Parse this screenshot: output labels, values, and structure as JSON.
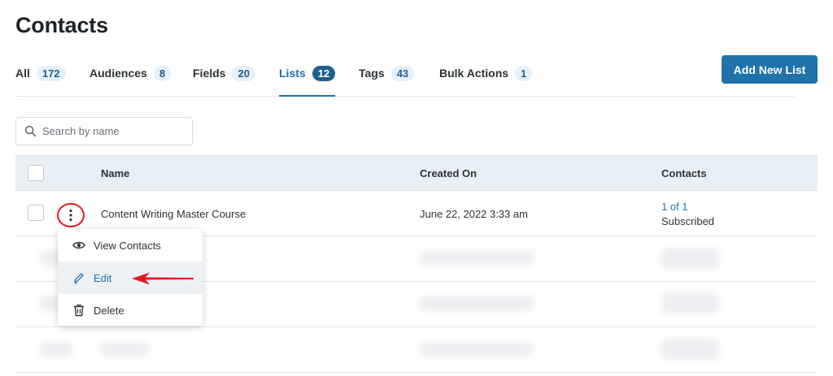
{
  "page": {
    "title": "Contacts"
  },
  "tabs": [
    {
      "label": "All",
      "count": "172"
    },
    {
      "label": "Audiences",
      "count": "8"
    },
    {
      "label": "Fields",
      "count": "20"
    },
    {
      "label": "Lists",
      "count": "12",
      "active": true
    },
    {
      "label": "Tags",
      "count": "43"
    },
    {
      "label": "Bulk Actions",
      "count": "1"
    }
  ],
  "toolbar": {
    "add_label": "Add New List"
  },
  "search": {
    "placeholder": "Search by name",
    "value": ""
  },
  "table": {
    "headers": {
      "name": "Name",
      "created": "Created On",
      "contacts": "Contacts"
    },
    "rows": [
      {
        "name": "Content Writing Master Course",
        "created": "June 22, 2022 3:33 am",
        "contacts_link": "1 of 1",
        "contacts_status": "Subscribed"
      }
    ]
  },
  "menu": {
    "items": [
      "View Contacts",
      "Edit",
      "Delete"
    ]
  },
  "colors": {
    "primary": "#1f72aa",
    "highlight_circle": "#e11b22",
    "arrow": "#e11b22"
  }
}
